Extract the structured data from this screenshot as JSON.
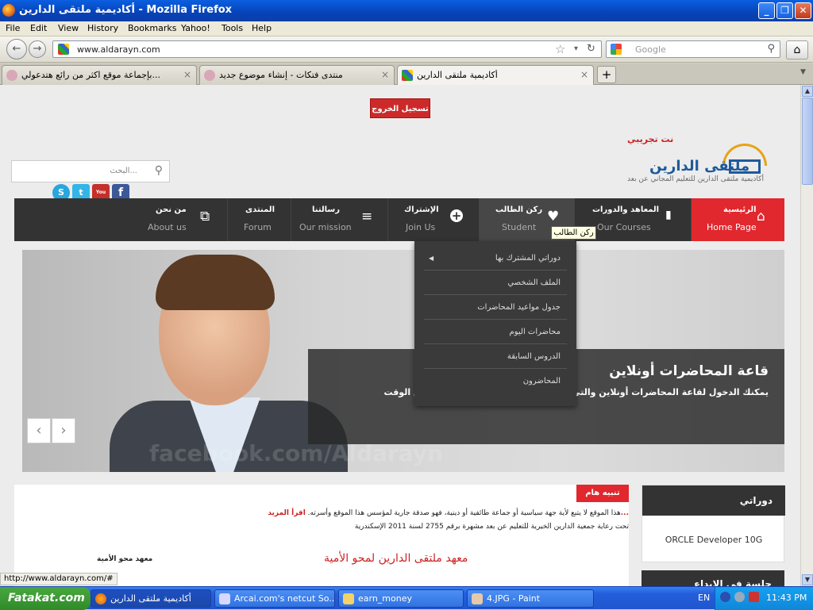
{
  "window": {
    "title": "أكاديمية ملتقى الدارين - Mozilla Firefox",
    "minimize": "_",
    "maximize": "❐",
    "close": "✕"
  },
  "menubar": [
    "File",
    "Edit",
    "View",
    "History",
    "Bookmarks",
    "Yahoo!",
    "Tools",
    "Help"
  ],
  "nav": {
    "back": "←",
    "forward": "→",
    "url": "www.aldarayn.com",
    "search_placeholder": "Google",
    "home": "⌂",
    "reload": "↻",
    "star": "☆",
    "dropdown": "▾"
  },
  "tabs": [
    {
      "title": "...بإجماعة موقع اكثر من رائع هتدعولي",
      "close": "×",
      "active": false
    },
    {
      "title": "منتدى فتكات - إنشاء موضوع جديد",
      "close": "×",
      "active": false
    },
    {
      "title": "أكاديمية ملتقى الدارين",
      "close": "×",
      "active": true
    }
  ],
  "newtab": "+",
  "page": {
    "logout": "تسجيل الخروج",
    "search_placeholder": "البحث...",
    "social": [
      "S",
      "t",
      "You Tube",
      "f"
    ],
    "logo": {
      "demo": "نت تجريبي",
      "name": "ملتقى الدارين",
      "tagline": "أكاديمية ملتقى الدارين للتعليم المجاني عن بعد"
    },
    "menu": [
      {
        "ar": "الرئيسية",
        "en": "Home Page",
        "icon": "⌂"
      },
      {
        "ar": "المعاهد والدورات",
        "en": "Our Courses",
        "icon": "▮"
      },
      {
        "ar": "ركن الطالب",
        "en": "Student",
        "icon": "♥"
      },
      {
        "ar": "الإشتراك",
        "en": "Join Us",
        "icon": "+"
      },
      {
        "ar": "رسالتنا",
        "en": "Our mission",
        "icon": "≡"
      },
      {
        "ar": "المنتدى",
        "en": "Forum",
        "icon": ""
      },
      {
        "ar": "من نحن",
        "en": "About us",
        "icon": "⧉"
      }
    ],
    "tooltip": "ركن الطالب",
    "dropdown": [
      "دوراتي المشترك بها",
      "الملف الشخصي",
      "جدول مواعيد المحاضرات",
      "محاضرات اليوم",
      "الدروس السابقة",
      "المحاضرون"
    ],
    "slider": {
      "title": "قاعة المحاضرات أونلاين",
      "desc": "يمكنك الدخول لقاعة المحاضرات أونلاين والتى تتسع لـ ... من 25 محاضرة فى نفس الوقت",
      "watermark": "facebook.com/Aldarayn",
      "prev": "‹",
      "next": "›"
    },
    "alert_label": "تنبيه هام",
    "notice": {
      "line1": "هذا الموقع لا يتبع لأية جهة سياسية أو جماعة طائفية أو دينية، فهو صدقة جارية لمؤسس هذا الموقع وأسرته.",
      "more": "اقرأ المزيد...",
      "line2": "تحت رعاية جمعية الدارين الخيرية للتعليم عن بعد مشهرة برقم 2755 لسنة 2011 الإسكندرية"
    },
    "institute_title": "معهد ملتقى الدارين لمحو الأمية",
    "institute_small": "معهد محو الأمية",
    "sidebar": {
      "header": "دوراتي",
      "item": "ORCLE Developer 10G",
      "header2": "جلسة في الابداع"
    }
  },
  "statusbar_url": "http://www.aldarayn.com/#",
  "taskbar": {
    "start": "Fatakat.com",
    "items": [
      {
        "label": "أكاديمية ملتقى الدارين",
        "active": true
      },
      {
        "label": "Arcai.com's netcut So...",
        "active": false
      },
      {
        "label": "earn_money",
        "active": false
      },
      {
        "label": "4.JPG - Paint",
        "active": false
      }
    ],
    "lang": "EN",
    "time": "11:43 PM"
  },
  "colors": {
    "accent_red": "#e0282e",
    "nav_dark": "#333333",
    "xp_blue": "#245edb"
  }
}
